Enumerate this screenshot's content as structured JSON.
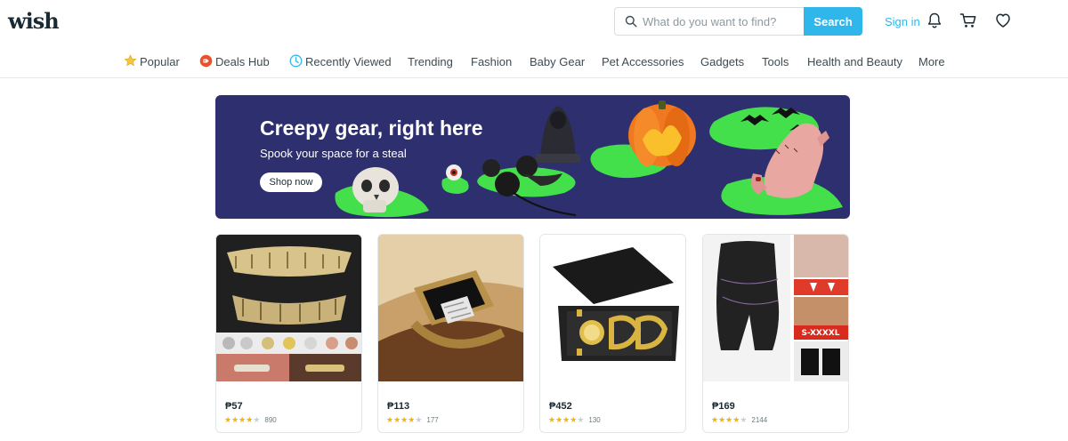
{
  "brand": {
    "logo": "wish"
  },
  "search": {
    "placeholder": "What do you want to find?",
    "button_label": "Search"
  },
  "header": {
    "signin_label": "Sign in",
    "icons": [
      "bell-icon",
      "cart-icon",
      "heart-icon"
    ]
  },
  "nav": {
    "items": [
      {
        "label": "Popular",
        "icon": "star-icon"
      },
      {
        "label": "Deals Hub",
        "icon": "deals-icon"
      },
      {
        "label": "Recently Viewed",
        "icon": "clock-icon"
      },
      {
        "label": "Trending"
      },
      {
        "label": "Fashion"
      },
      {
        "label": "Baby Gear"
      },
      {
        "label": "Pet Accessories"
      },
      {
        "label": "Gadgets"
      },
      {
        "label": "Tools"
      },
      {
        "label": "Health and Beauty"
      },
      {
        "label": "More"
      }
    ]
  },
  "banner": {
    "title": "Creepy gear, right here",
    "subtitle": "Spook your space for a steal",
    "button_label": "Shop now",
    "colors": {
      "background": "#2e2f6e",
      "slime": "#43e04b"
    }
  },
  "products": [
    {
      "price": "₱57",
      "stars": 4,
      "reviews": "890",
      "image": "gold-teeth-grillz"
    },
    {
      "price": "₱113",
      "stars": 4,
      "reviews": "177",
      "image": "gold-ring"
    },
    {
      "price": "₱452",
      "stars": 4,
      "reviews": "130",
      "image": "gold-watch-chain-set"
    },
    {
      "price": "₱169",
      "stars": 4,
      "reviews": "2144",
      "image": "shapewear-shorts"
    }
  ],
  "colors": {
    "accent": "#2fb7ec",
    "star": "#f5b301",
    "star_empty": "#c9d0d4",
    "text": "#192a32"
  }
}
